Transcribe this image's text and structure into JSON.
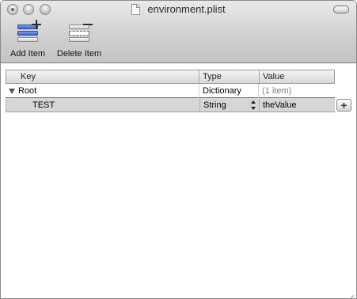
{
  "window": {
    "title": "environment.plist",
    "icons": {
      "document": "document-icon",
      "resize": "resize-grip-icon"
    }
  },
  "toolbar": {
    "add_label": "Add Item",
    "delete_label": "Delete Item",
    "add_icon": "add-item-icon",
    "delete_icon": "delete-item-icon"
  },
  "table": {
    "headers": {
      "key": "Key",
      "type": "Type",
      "value": "Value"
    },
    "rows": [
      {
        "key": "Root",
        "type": "Dictionary",
        "value": "(1 item)",
        "expanded": true
      },
      {
        "key": "TEST",
        "type": "String",
        "value": "theValue",
        "selected": true
      }
    ],
    "add_sibling_label": "+"
  },
  "colors": {
    "selection_row": "#d6d6d6",
    "root_underline": "#3d6fd6",
    "add_icon_blue": "#3a63cf"
  }
}
